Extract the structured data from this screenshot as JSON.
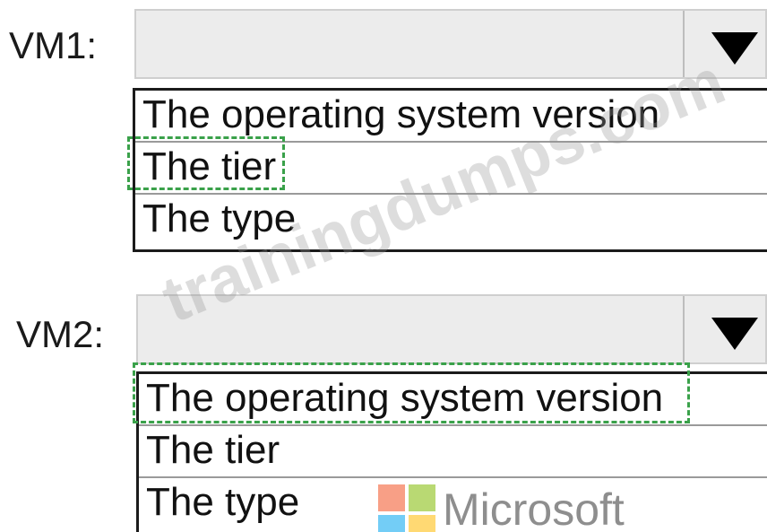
{
  "vm1": {
    "label": "VM1:",
    "selected_value": "",
    "options": [
      "The operating system version",
      "The tier",
      "The type"
    ],
    "highlighted_option": "The tier"
  },
  "vm2": {
    "label": "VM2:",
    "selected_value": "",
    "options": [
      "The operating system version",
      "The tier",
      "The type"
    ],
    "highlighted_option": "The operating system version"
  },
  "watermark": {
    "text": "trainingdumps.com"
  },
  "branding": {
    "wordmark": "Microsoft",
    "logo_colors": [
      "#f25022",
      "#7fba00",
      "#00a4ef",
      "#ffb900"
    ]
  },
  "colors": {
    "selection_dash": "#3aa14a",
    "dropdown_bg": "#ececec"
  },
  "icons": {
    "dropdown_arrow": "triangle-down-icon"
  }
}
